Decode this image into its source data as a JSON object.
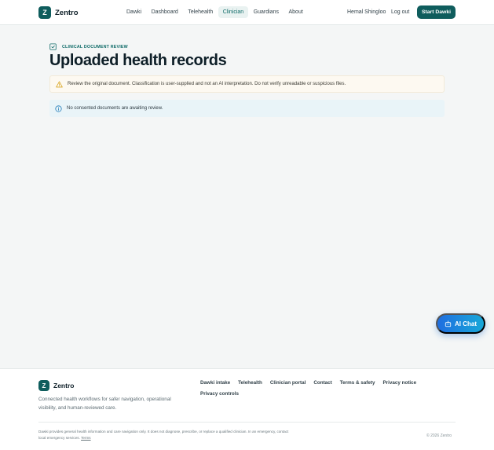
{
  "header": {
    "logo_letter": "Z",
    "brand": "Zentro",
    "nav": [
      {
        "label": "Dawki"
      },
      {
        "label": "Dashboard"
      },
      {
        "label": "Telehealth"
      },
      {
        "label": "Clinician"
      },
      {
        "label": "Guardians"
      },
      {
        "label": "About"
      }
    ],
    "active_nav": "Clinician",
    "user_name": "Hemal Shingloo",
    "logout_label": "Log out",
    "cta_label": "Start Dawki"
  },
  "main": {
    "eyebrow_icon": "clipboard-check-icon",
    "eyebrow": "CLINICAL DOCUMENT REVIEW",
    "title": "Uploaded health records",
    "warning_icon": "warning-triangle-icon",
    "warning_text": "Review the original document. Classification is user-supplied and not an AI interpretation. Do not verify unreadable or suspicious files.",
    "info_icon": "info-circle-icon",
    "info_text": "No consented documents are awaiting review."
  },
  "ai_chat": {
    "icon": "robot-icon",
    "label": "AI Chat"
  },
  "footer": {
    "logo_letter": "Z",
    "brand": "Zentro",
    "tagline": "Connected health workflows for safer navigation, operational visibility, and human-reviewed care.",
    "links": [
      {
        "label": "Dawki intake"
      },
      {
        "label": "Telehealth"
      },
      {
        "label": "Clinician portal"
      },
      {
        "label": "Contact"
      },
      {
        "label": "Terms & safety"
      },
      {
        "label": "Privacy notice"
      },
      {
        "label": "Privacy controls"
      }
    ],
    "disclaimer": "Dawki provides general health information and care navigation only. It does not diagnose, prescribe, or replace a qualified clinician. In an emergency, contact local emergency services.",
    "terms_label": "Terms",
    "copyright": "© 2026 Zentro"
  },
  "colors": {
    "brand": "#0f5d5d",
    "accent": "#0f6b68",
    "warning_bg": "#fdf9f1",
    "warning_icon": "#d9a520",
    "info_bg": "#e9f4f8",
    "info_icon": "#1e7ab8",
    "chat_gradient_start": "#1f6ee0",
    "chat_gradient_end": "#17a8d8"
  }
}
